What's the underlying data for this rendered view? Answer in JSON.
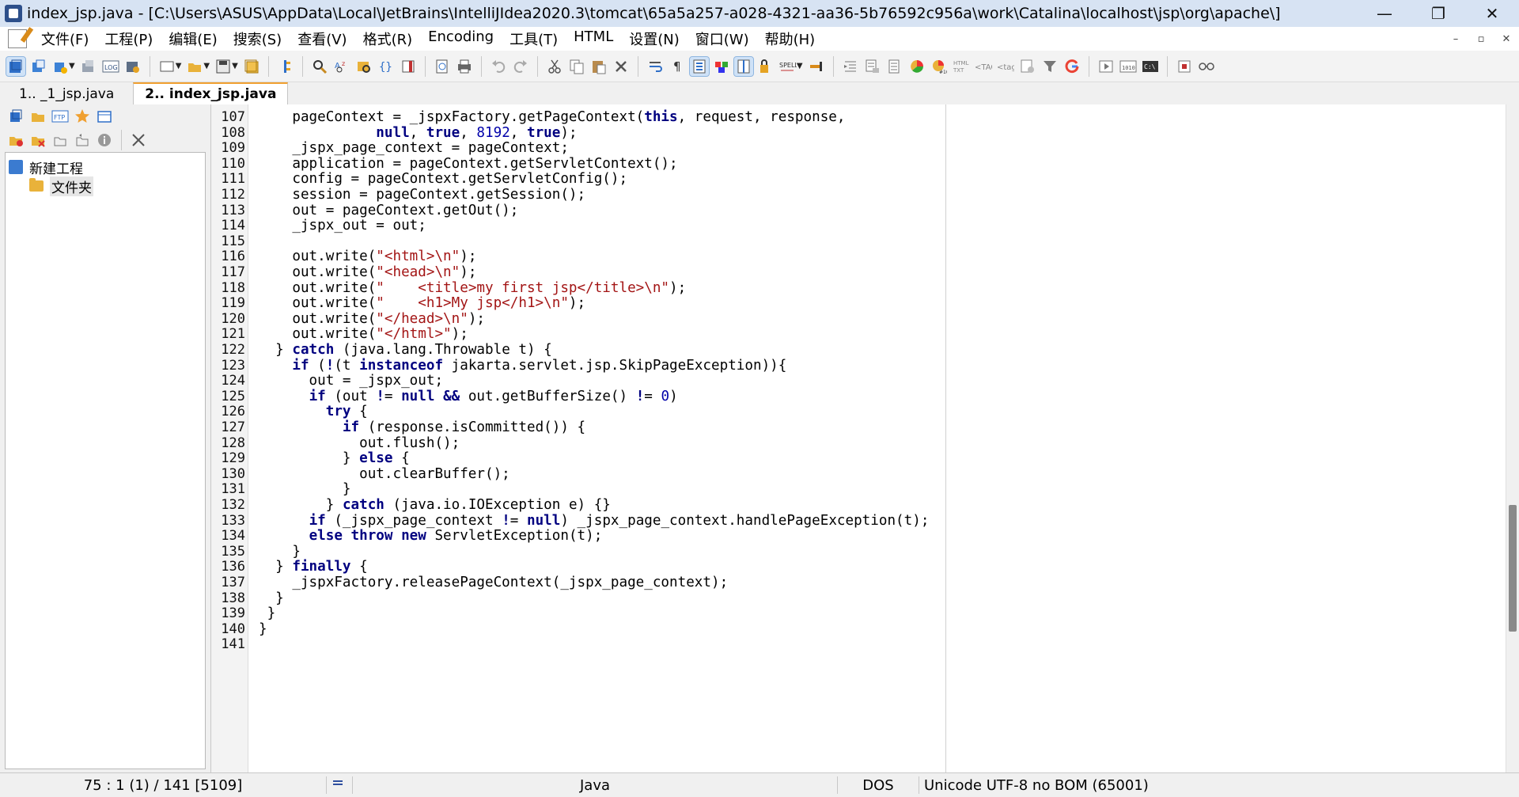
{
  "window": {
    "title": "index_jsp.java - [C:\\Users\\ASUS\\AppData\\Local\\JetBrains\\IntelliJIdea2020.3\\tomcat\\65a5a257-a028-4321-aa36-5b76592c956a\\work\\Catalina\\localhost\\jsp\\org\\apache\\]",
    "minimize": "—",
    "maximize": "❐",
    "close": "✕"
  },
  "menu": [
    "文件(F)",
    "工程(P)",
    "编辑(E)",
    "搜索(S)",
    "查看(V)",
    "格式(R)",
    "Encoding",
    "工具(T)",
    "HTML",
    "设置(N)",
    "窗口(W)",
    "帮助(H)"
  ],
  "mdi": {
    "minimize": "–",
    "restore": "▫",
    "close": "✕"
  },
  "tabs": [
    "1.. _1_jsp.java",
    "2.. index_jsp.java"
  ],
  "active_tab": 1,
  "tree": {
    "project": "新建工程",
    "folder": "文件夹"
  },
  "code_lines": [
    {
      "n": "107",
      "t": "    pageContext = _jspxFactory.getPageContext(this, request, response,"
    },
    {
      "n": "108",
      "t": "              null, true, 8192, true);"
    },
    {
      "n": "109",
      "t": "    _jspx_page_context = pageContext;"
    },
    {
      "n": "110",
      "t": "    application = pageContext.getServletContext();"
    },
    {
      "n": "111",
      "t": "    config = pageContext.getServletConfig();"
    },
    {
      "n": "112",
      "t": "    session = pageContext.getSession();"
    },
    {
      "n": "113",
      "t": "    out = pageContext.getOut();"
    },
    {
      "n": "114",
      "t": "    _jspx_out = out;"
    },
    {
      "n": "115",
      "t": ""
    },
    {
      "n": "116",
      "t": "    out.write(\"<html>\\n\");"
    },
    {
      "n": "117",
      "t": "    out.write(\"<head>\\n\");"
    },
    {
      "n": "118",
      "t": "    out.write(\"    <title>my first jsp</title>\\n\");"
    },
    {
      "n": "119",
      "t": "    out.write(\"    <h1>My jsp</h1>\\n\");"
    },
    {
      "n": "120",
      "t": "    out.write(\"</head>\\n\");"
    },
    {
      "n": "121",
      "t": "    out.write(\"</html>\");"
    },
    {
      "n": "122",
      "t": "  } catch (java.lang.Throwable t) {"
    },
    {
      "n": "123",
      "t": "    if (!(t instanceof jakarta.servlet.jsp.SkipPageException)){"
    },
    {
      "n": "124",
      "t": "      out = _jspx_out;"
    },
    {
      "n": "125",
      "t": "      if (out != null && out.getBufferSize() != 0)"
    },
    {
      "n": "126",
      "t": "        try {"
    },
    {
      "n": "127",
      "t": "          if (response.isCommitted()) {"
    },
    {
      "n": "128",
      "t": "            out.flush();"
    },
    {
      "n": "129",
      "t": "          } else {"
    },
    {
      "n": "130",
      "t": "            out.clearBuffer();"
    },
    {
      "n": "131",
      "t": "          }"
    },
    {
      "n": "132",
      "t": "        } catch (java.io.IOException e) {}"
    },
    {
      "n": "133",
      "t": "      if (_jspx_page_context != null) _jspx_page_context.handlePageException(t);"
    },
    {
      "n": "134",
      "t": "      else throw new ServletException(t);"
    },
    {
      "n": "135",
      "t": "    }"
    },
    {
      "n": "136",
      "t": "  } finally {"
    },
    {
      "n": "137",
      "t": "    _jspxFactory.releasePageContext(_jspx_page_context);"
    },
    {
      "n": "138",
      "t": "  }"
    },
    {
      "n": "139",
      "t": " }"
    },
    {
      "n": "140",
      "t": "}"
    },
    {
      "n": "141",
      "t": ""
    }
  ],
  "status": {
    "position": "75 : 1 (1) / 141  [5109]",
    "language": "Java",
    "line_endings": "DOS",
    "encoding": "Unicode UTF-8 no BOM (65001)"
  },
  "colors": {
    "keyword": "#000080",
    "string": "#a31515",
    "number": "#0000aa"
  }
}
